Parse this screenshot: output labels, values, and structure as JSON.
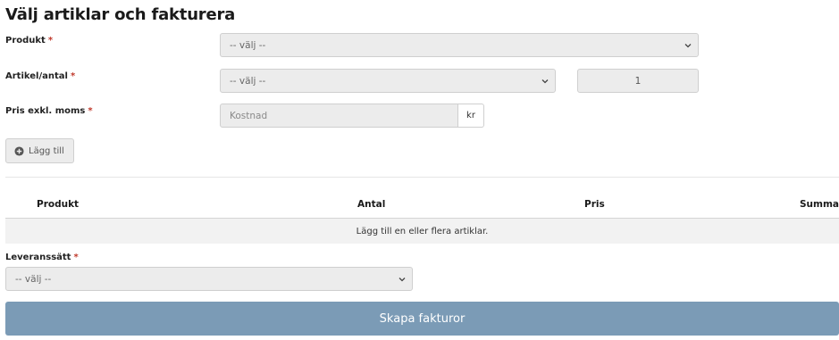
{
  "page_title": "Välj artiklar och fakturera",
  "required_mark": "*",
  "form": {
    "product": {
      "label": "Produkt",
      "selected": "-- välj --"
    },
    "article": {
      "label": "Artikel/antal",
      "selected": "-- välj --",
      "quantity": "1"
    },
    "price": {
      "label": "Pris exkl. moms",
      "placeholder": "Kostnad",
      "unit": "kr"
    },
    "add_button": {
      "label": "Lägg till",
      "icon": "plus-circle-icon"
    }
  },
  "table": {
    "headers": [
      "Produkt",
      "Antal",
      "Pris",
      "Summa"
    ],
    "empty_message": "Lägg till en eller flera artiklar."
  },
  "delivery": {
    "label": "Leveranssätt",
    "selected": "-- välj --"
  },
  "submit": {
    "label": "Skapa fakturor"
  },
  "colors": {
    "required": "#c0392b",
    "submit_bg": "#7b9bb6",
    "field_bg": "#ececec"
  }
}
